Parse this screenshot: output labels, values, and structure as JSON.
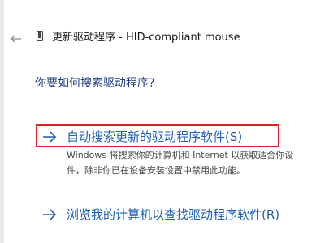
{
  "window": {
    "title": "更新驱动程序 - HID-compliant mouse"
  },
  "main": {
    "question": "你要如何搜索驱动程序?",
    "options": [
      {
        "label": "自动搜索更新的驱动程序软件(S)",
        "description_line1": "Windows 将搜索你的计算机和 Internet 以获取适合你设",
        "description_line2": "件，除非你已在设备安装设置中禁用此功能。"
      },
      {
        "label": "浏览我的计算机以查找驱动程序软件(R)"
      }
    ]
  },
  "colors": {
    "link": "#1e5fb4",
    "heading": "#1f3f84",
    "highlight_border": "#e11d28"
  },
  "icons": [
    "back-arrow-icon",
    "device-icon",
    "right-arrow-icon"
  ]
}
